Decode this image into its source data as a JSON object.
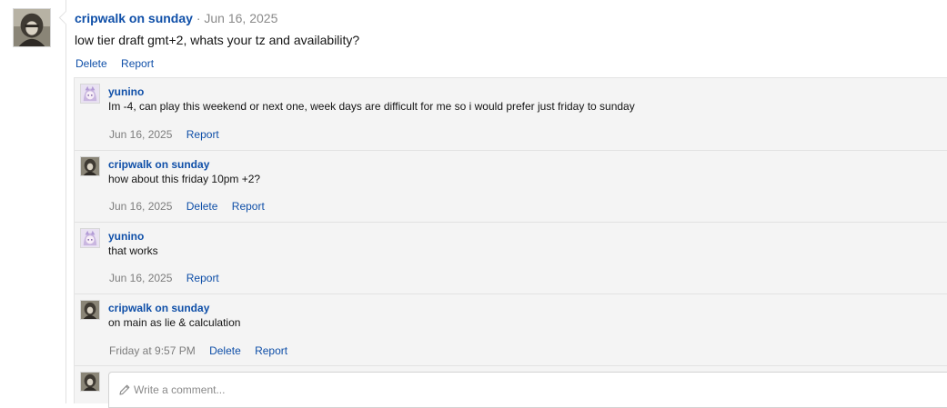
{
  "post": {
    "author": "cripwalk on sunday",
    "separator": "·",
    "date": "Jun 16, 2025",
    "body": "low tier draft gmt+2, whats your tz and availability?",
    "actions": {
      "delete": "Delete",
      "report": "Report"
    }
  },
  "replies": [
    {
      "author": "yunino",
      "avatar": "anime-avatar",
      "body": "Im -4, can play this weekend or next one, week days are difficult for me so i would prefer just friday to sunday",
      "date": "Jun 16, 2025",
      "report": "Report"
    },
    {
      "author": "cripwalk on sunday",
      "avatar": "hooded-avatar",
      "body": "how about this friday 10pm +2?",
      "date": "Jun 16, 2025",
      "delete": "Delete",
      "report": "Report"
    },
    {
      "author": "yunino",
      "avatar": "anime-avatar",
      "body": "that works",
      "date": "Jun 16, 2025",
      "report": "Report"
    },
    {
      "author": "cripwalk on sunday",
      "avatar": "hooded-avatar",
      "body": "on main as lie & calculation",
      "date": "Friday at 9:57 PM",
      "delete": "Delete",
      "report": "Report"
    }
  ],
  "comment": {
    "placeholder": "Write a comment...",
    "icon": "pencil-icon"
  },
  "colors": {
    "link": "#0f4fa8",
    "muted": "#8a8a8a",
    "reply_bg": "#f4f4f4"
  }
}
